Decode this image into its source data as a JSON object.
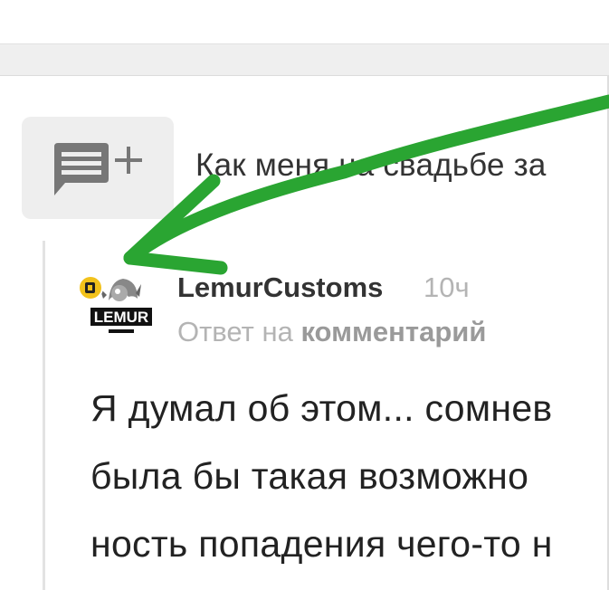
{
  "post": {
    "title": "Как меня на свадьбе за"
  },
  "comment": {
    "username": "LemurCustoms",
    "time": "10ч",
    "reply_prefix": "Ответ на ",
    "reply_link": "комментарий",
    "body_lines": [
      "Я думал об этом... сомнев",
      "была бы такая возможно",
      "ность попадения чего-то н"
    ],
    "avatar_text": "LEMUR"
  },
  "icons": {
    "reply": "add-comment-icon",
    "badge": "document-badge-icon"
  },
  "colors": {
    "arrow": "#2aa532",
    "badge": "#f2c21b",
    "text": "#333333",
    "muted": "#b4b4b4"
  }
}
